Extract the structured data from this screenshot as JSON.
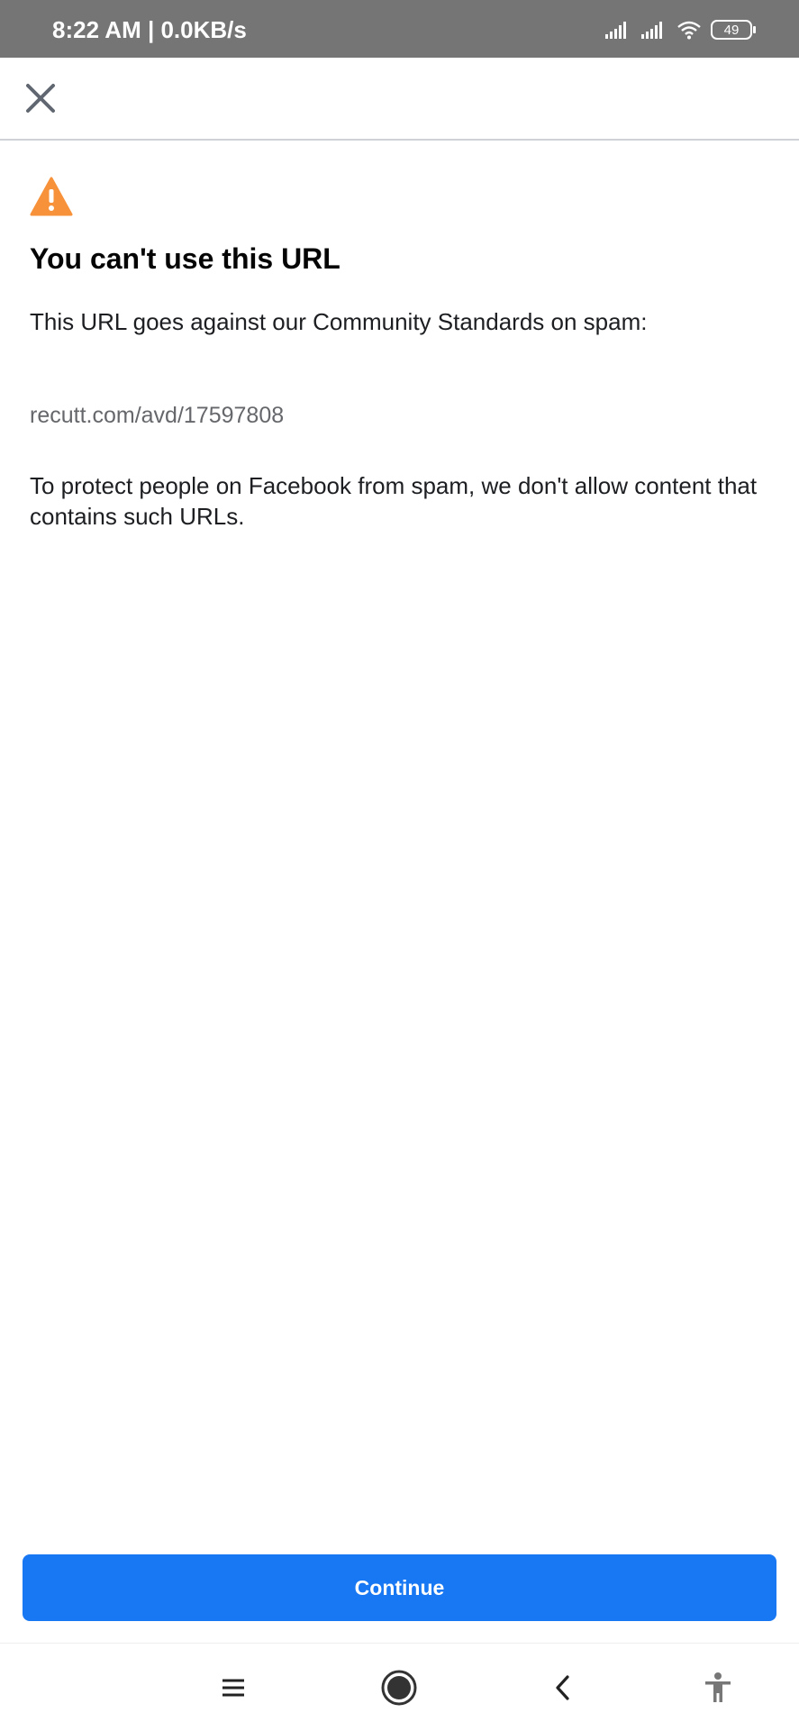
{
  "status_bar": {
    "time_speed": "8:22 AM | 0.0KB/s",
    "battery_level": "49",
    "icons": [
      "signal-icon",
      "signal-icon",
      "wifi-icon",
      "battery-icon"
    ]
  },
  "top_nav": {
    "close_icon": "close-icon"
  },
  "main": {
    "icon": "warning-icon",
    "warning_color": "#f7923a",
    "title": "You can't use this URL",
    "description": "This URL goes against our Community Standards on spam:",
    "url": "recutt.com/avd/17597808",
    "protect_text": "To protect people on Facebook from spam, we don't allow content that contains such URLs."
  },
  "continue": {
    "label": "Continue",
    "color": "#1877f2"
  },
  "nav_bar": {
    "icons": [
      "menu-icon",
      "home-icon",
      "back-icon",
      "accessibility-icon"
    ]
  }
}
